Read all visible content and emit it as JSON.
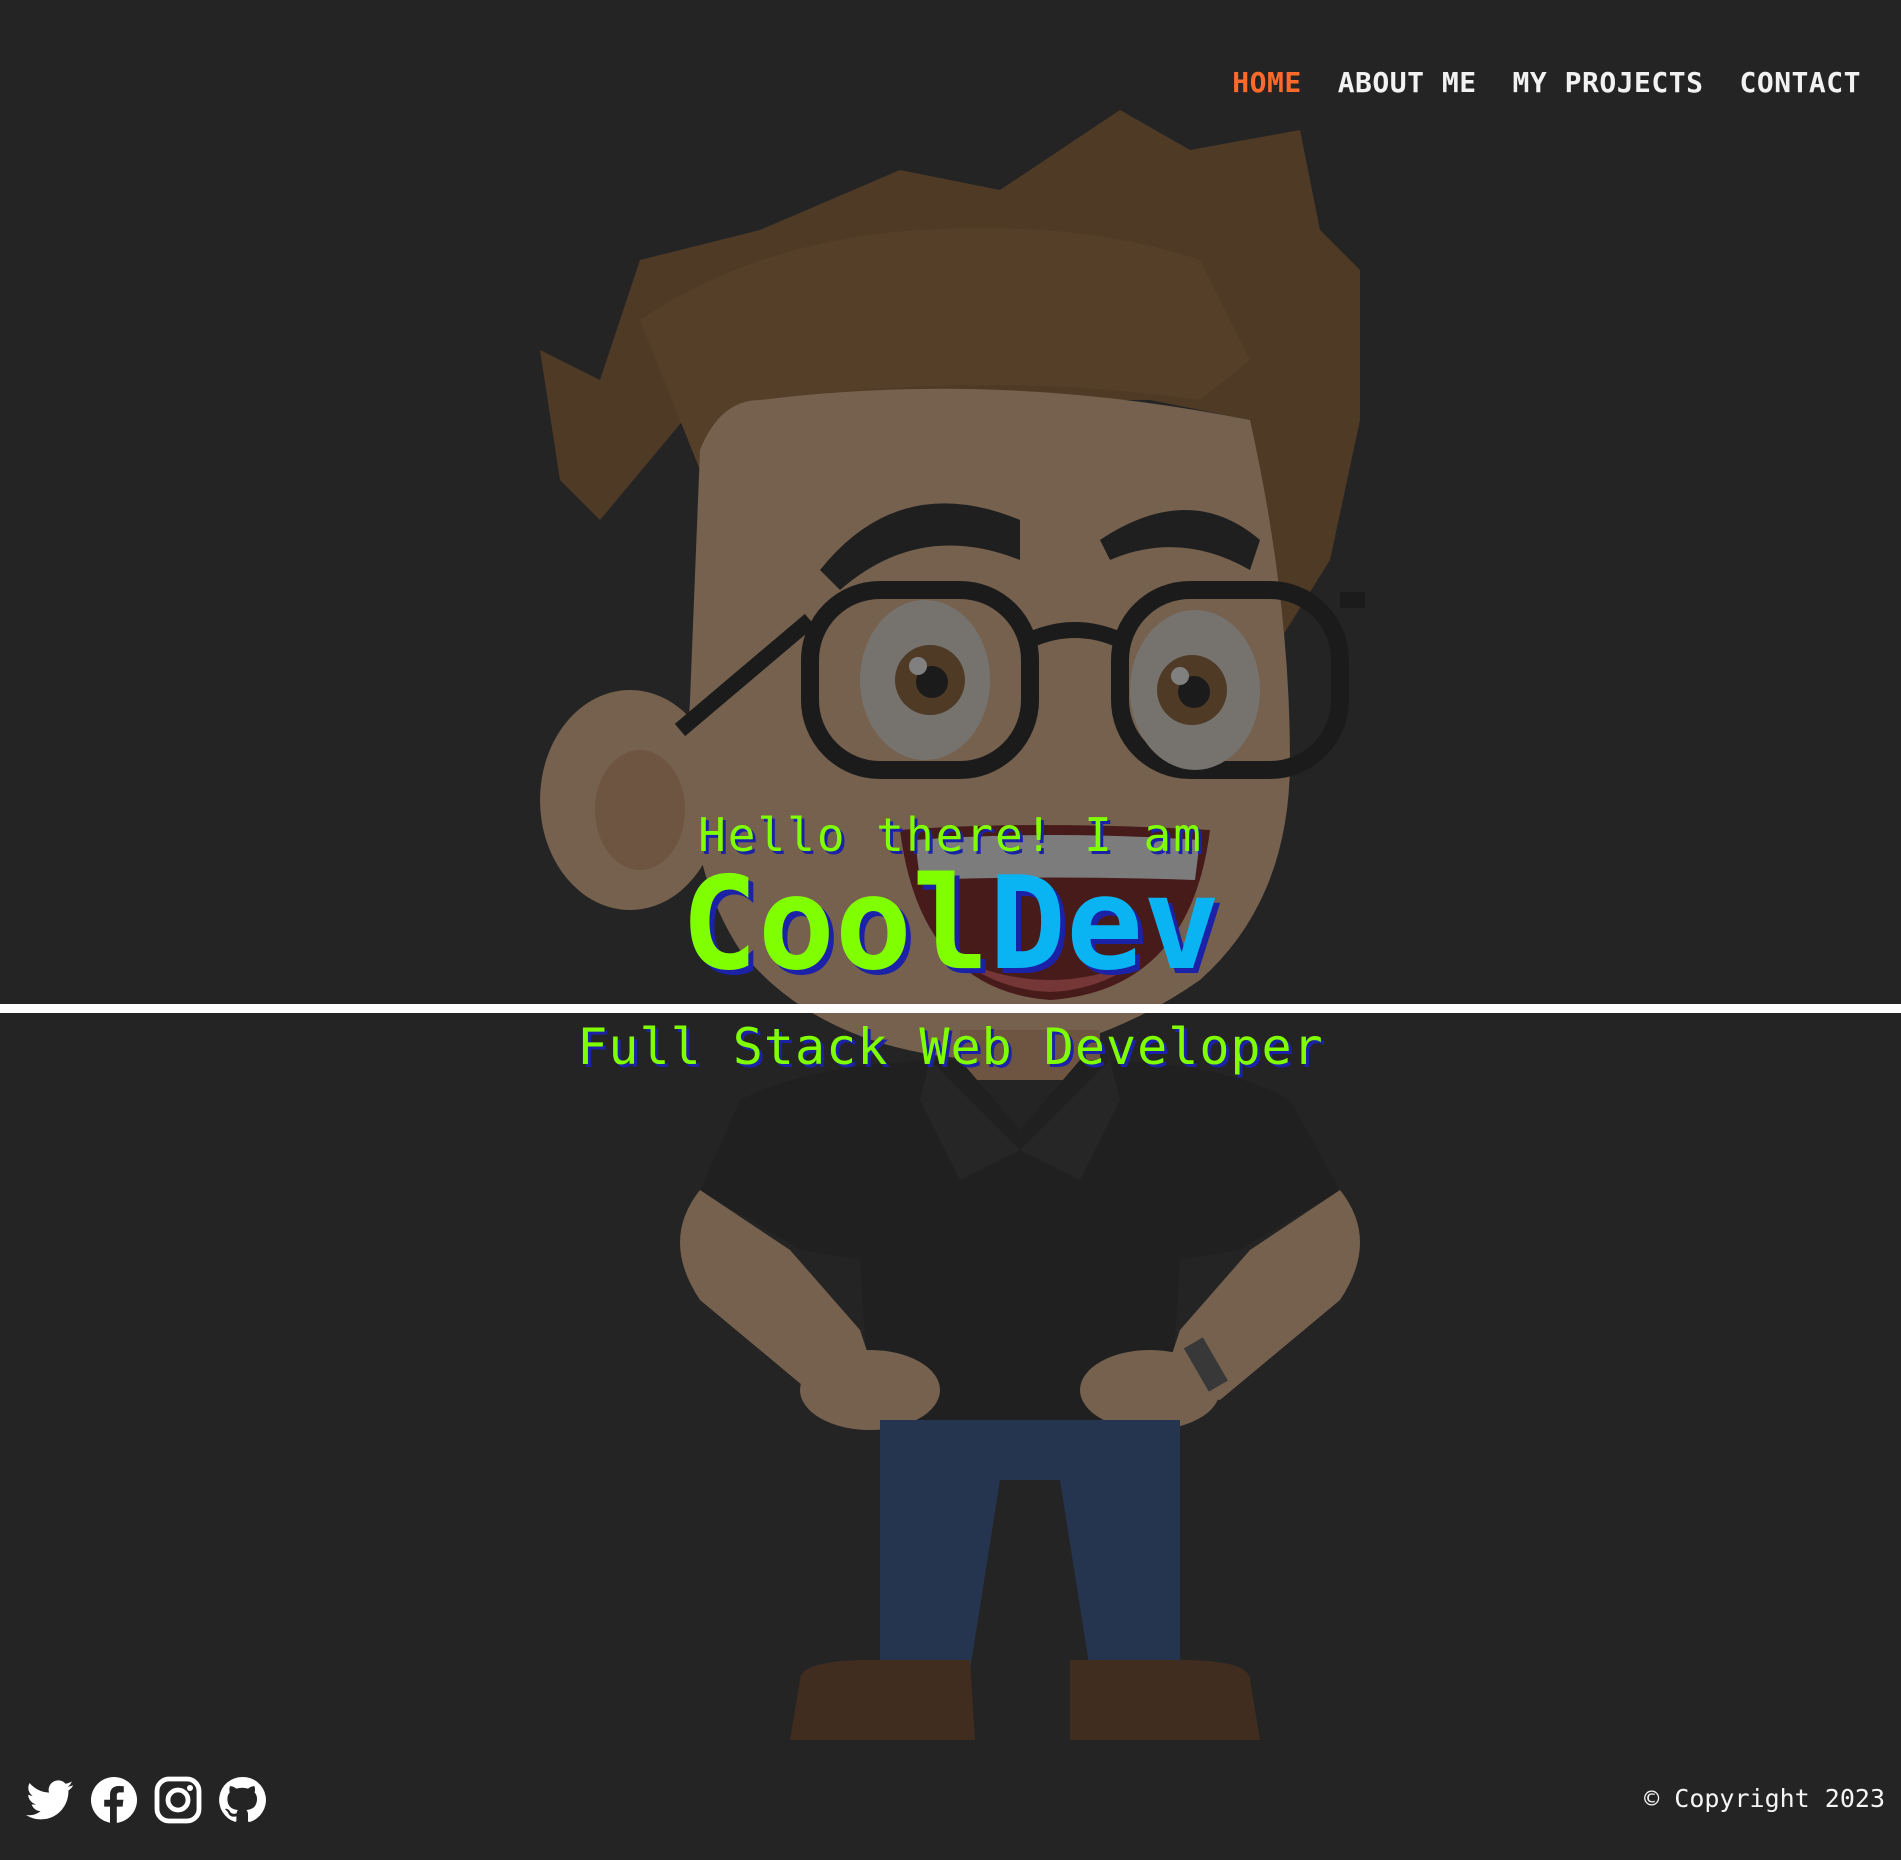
{
  "nav": {
    "items": [
      {
        "label": "HOME",
        "active": true
      },
      {
        "label": "ABOUT ME",
        "active": false
      },
      {
        "label": "MY PROJECTS",
        "active": false
      },
      {
        "label": "CONTACT",
        "active": false
      }
    ]
  },
  "hero": {
    "greeting": "Hello there! I am",
    "name_part1": "Cool",
    "name_part2": "Dev",
    "role": "Full Stack Web Developer"
  },
  "footer": {
    "social_icons": [
      "twitter-icon",
      "facebook-icon",
      "instagram-icon",
      "github-icon"
    ],
    "copyright": "© Copyright 2023"
  },
  "colors": {
    "background": "#242424",
    "nav_active": "#ff6a2b",
    "accent_green": "#7fff00",
    "accent_blue": "#0ab4f2",
    "text_shadow": "#1b22a8"
  }
}
